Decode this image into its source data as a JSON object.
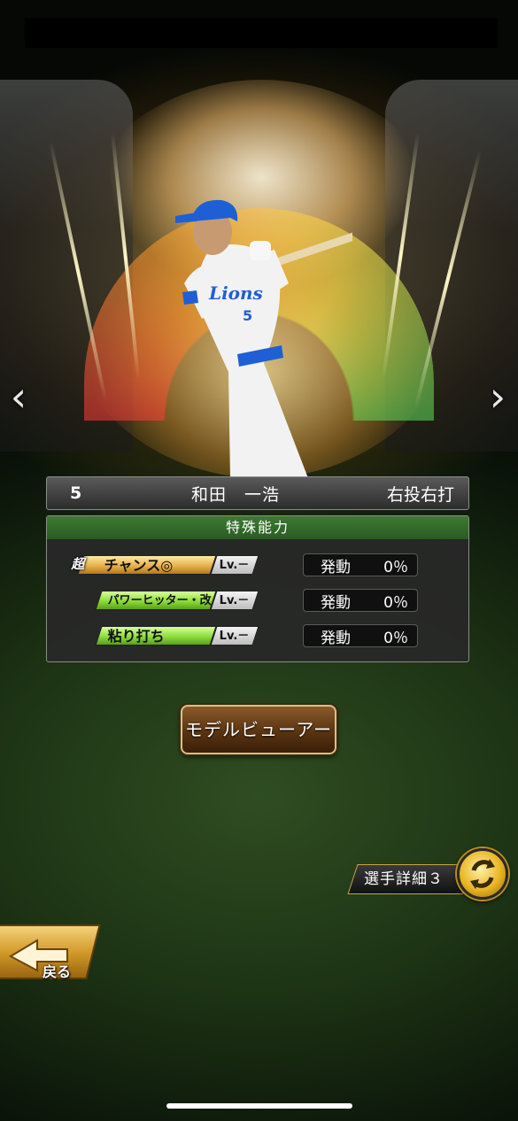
{
  "player": {
    "number": "5",
    "name": "和田　一浩",
    "hand": "右投右打",
    "uniform_text": "Lions"
  },
  "abilities": {
    "header": "特殊能力",
    "items": [
      {
        "label": "チャンス◎",
        "super_mark": "超",
        "level": "Lv.－",
        "activation_label": "発動",
        "activation_value": "0％"
      },
      {
        "label": "パワーヒッター・改",
        "level": "Lv.－",
        "activation_label": "発動",
        "activation_value": "0％"
      },
      {
        "label": "粘り打ち",
        "level": "Lv.－",
        "activation_label": "発動",
        "activation_value": "0％"
      }
    ]
  },
  "buttons": {
    "model_viewer": "モデルビューアー",
    "player_detail": "選手詳細３",
    "back": "戻る"
  },
  "nav": {
    "prev_icon": "chevron-left-icon",
    "next_icon": "chevron-right-icon",
    "swap_icon": "swap-arrows-icon"
  },
  "colors": {
    "ability_header_green": "#2f6a28",
    "gold_tag": "#e6b24a",
    "green_tag": "#8ddc3a",
    "button_brown": "#5a3412"
  }
}
